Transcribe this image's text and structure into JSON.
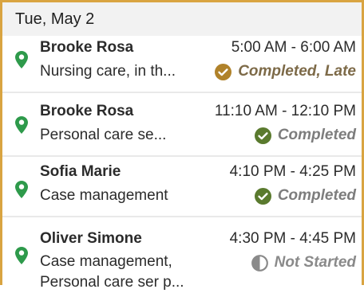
{
  "day": {
    "label": "Tue, May 2"
  },
  "colors": {
    "pin": "#2e9a4b",
    "completed": "#5a7a2e",
    "late": "#b0822a",
    "frame": "#d9a441"
  },
  "visits": [
    {
      "client": "Brooke Rosa",
      "time": "5:00 AM - 6:00 AM",
      "service": "Nursing care, in th...",
      "status": "Completed, Late",
      "status_icon": "check-circle-icon"
    },
    {
      "client": "Brooke Rosa",
      "time": "11:10 AM - 12:10 PM",
      "service": "Personal care se...",
      "status": "Completed",
      "status_icon": "check-circle-icon"
    },
    {
      "client": "Sofia Marie",
      "time": "4:10 PM - 4:25 PM",
      "service": "Case management",
      "status": "Completed",
      "status_icon": "check-circle-icon"
    },
    {
      "client": "Oliver Simone",
      "time": "4:30 PM - 4:45 PM",
      "service_line1": "Case management,",
      "service_line2": "Personal care ser p...",
      "status": "Not Started",
      "status_icon": "half-circle-icon"
    }
  ]
}
